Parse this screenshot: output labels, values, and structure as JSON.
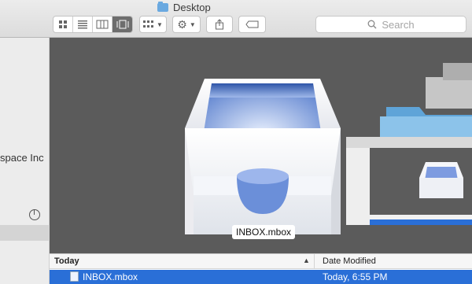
{
  "window": {
    "title": "Desktop"
  },
  "toolbar": {
    "view_icons": [
      "icon-view-icon",
      "list-view-icon",
      "column-view-icon",
      "coverflow-view-icon"
    ],
    "arrange_icon": "arrange-grid-icon",
    "action_icon": "gear-icon",
    "share_icon": "share-icon",
    "tag_icon": "tag-icon"
  },
  "search": {
    "placeholder": "Search"
  },
  "sidebar": {
    "truncated_item": "space Inc"
  },
  "preview": {
    "caption": "INBOX.mbox"
  },
  "list": {
    "headers": {
      "name": "Today",
      "date": "Date Modified"
    },
    "rows": [
      {
        "name": "INBOX.mbox",
        "date": "Today, 6:55 PM"
      }
    ]
  },
  "colors": {
    "selection": "#2a6fd7",
    "preview_bg": "#5b5b5b"
  }
}
